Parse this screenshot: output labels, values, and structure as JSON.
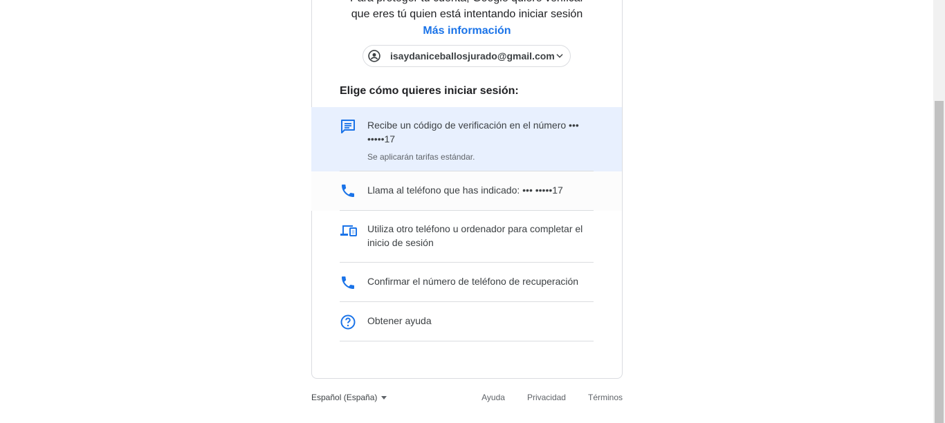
{
  "intro": {
    "line1": "Para proteger tu cuenta, Google quiere verificar",
    "line2": "que eres tú quien está intentando iniciar sesión",
    "link": "Más información"
  },
  "account": {
    "email": "isaydaniceballosjurado@gmail.com",
    "avatar_icon": "account-circle-icon",
    "chevron_icon": "chevron-down-icon"
  },
  "heading": "Elige cómo quieres iniciar sesión:",
  "options": [
    {
      "icon": "sms-icon",
      "label": "Recibe un código de verificación en el número ••• •••••17",
      "sub": "Se aplicarán tarifas estándar."
    },
    {
      "icon": "phone-icon",
      "label": "Llama al teléfono que has indicado: ••• •••••17"
    },
    {
      "icon": "devices-icon",
      "label": "Utiliza otro teléfono u ordenador para completar el inicio de sesión"
    },
    {
      "icon": "phone-icon",
      "label": "Confirmar el número de teléfono de recuperación"
    },
    {
      "icon": "help-circle-icon",
      "label": "Obtener ayuda"
    }
  ],
  "footer": {
    "language": "Español (España)",
    "links": [
      "Ayuda",
      "Privacidad",
      "Términos"
    ]
  },
  "colors": {
    "accent": "#1a73e8",
    "selected_bg": "#e8f0fe",
    "divider": "#dadce0"
  }
}
